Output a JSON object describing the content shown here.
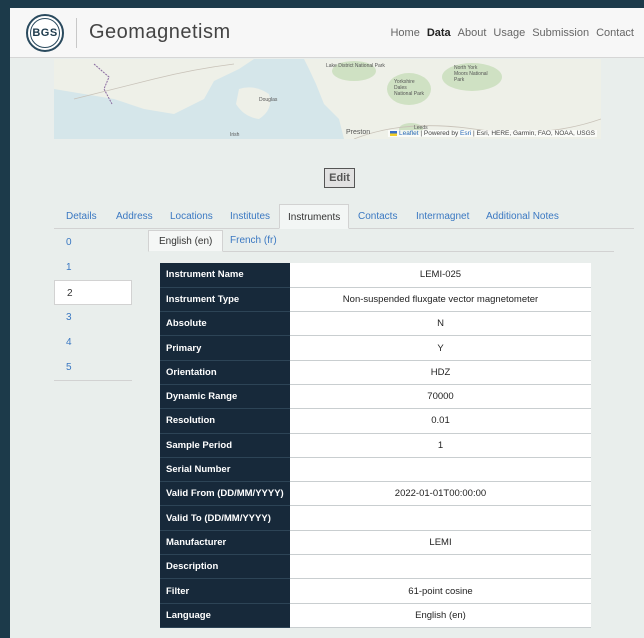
{
  "header": {
    "logo_text": "BGS",
    "title": "Geomagnetism",
    "nav": [
      {
        "label": "Home",
        "active": false
      },
      {
        "label": "Data",
        "active": true
      },
      {
        "label": "About",
        "active": false
      },
      {
        "label": "Usage",
        "active": false
      },
      {
        "label": "Submission",
        "active": false
      },
      {
        "label": "Contact",
        "active": false
      }
    ]
  },
  "map": {
    "labels": [
      "Lake District National Park",
      "Yorkshire Dales National Park",
      "North York Moors National Park",
      "Douglas",
      "Preston",
      "Leeds",
      "Irish"
    ],
    "attribution": {
      "leaflet": "Leaflet",
      "powered_by": "| Powered by",
      "esri": "Esri",
      "sources": "| Esri, HERE, Garmin, FAO, NOAA, USGS"
    }
  },
  "edit_label": "Edit",
  "tabs": [
    "Details",
    "Address",
    "Locations",
    "Institutes",
    "Instruments",
    "Contacts",
    "Intermagnet",
    "Additional Notes"
  ],
  "active_tab": "Instruments",
  "indices": [
    "0",
    "1",
    "2",
    "3",
    "4",
    "5"
  ],
  "active_index": "2",
  "lang_tabs": [
    "English (en)",
    "French (fr)"
  ],
  "rows": [
    {
      "key": "Instrument Name",
      "value": "LEMI-025"
    },
    {
      "key": "Instrument Type",
      "value": "Non-suspended fluxgate vector magnetometer"
    },
    {
      "key": "Absolute",
      "value": "N"
    },
    {
      "key": "Primary",
      "value": "Y"
    },
    {
      "key": "Orientation",
      "value": "HDZ"
    },
    {
      "key": "Dynamic Range",
      "value": "70000"
    },
    {
      "key": "Resolution",
      "value": "0.01"
    },
    {
      "key": "Sample Period",
      "value": "1"
    },
    {
      "key": "Serial Number",
      "value": ""
    },
    {
      "key": "Valid From (DD/MM/YYYY)",
      "value": "2022-01-01T00:00:00"
    },
    {
      "key": "Valid To (DD/MM/YYYY)",
      "value": ""
    },
    {
      "key": "Manufacturer",
      "value": "LEMI"
    },
    {
      "key": "Description",
      "value": ""
    },
    {
      "key": "Filter",
      "value": "61-point cosine"
    },
    {
      "key": "Language",
      "value": "English (en)"
    }
  ]
}
